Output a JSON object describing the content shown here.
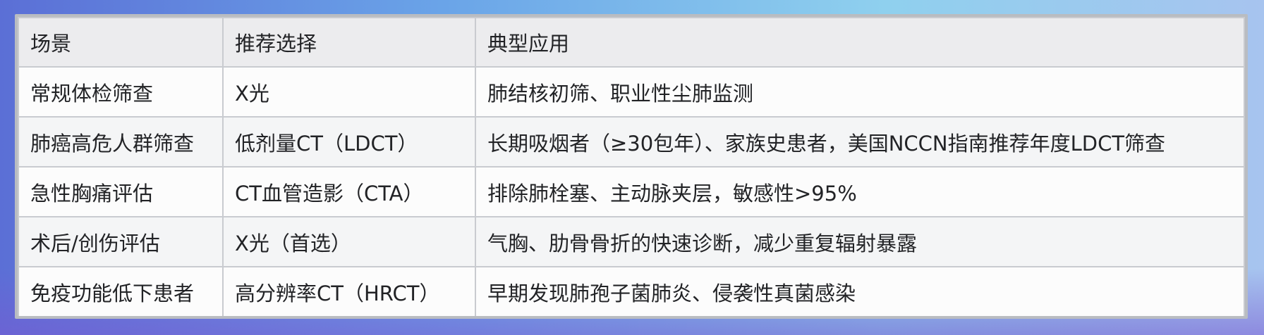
{
  "table": {
    "headers": [
      "场景",
      "推荐选择",
      "典型应用"
    ],
    "rows": [
      [
        "常规体检筛查",
        "X光",
        "肺结核初筛、职业性尘肺监测"
      ],
      [
        "肺癌高危人群筛查",
        "低剂量CT（LDCT）",
        "长期吸烟者（≥30包年）、家族史患者，美国NCCN指南推荐年度LDCT筛查"
      ],
      [
        "急性胸痛评估",
        "CT血管造影（CTA）",
        "排除肺栓塞、主动脉夹层，敏感性>95%"
      ],
      [
        "术后/创伤评估",
        "X光（首选）",
        "气胸、肋骨骨折的快速诊断，减少重复辐射暴露"
      ],
      [
        "免疫功能低下患者",
        "高分辨率CT（HRCT）",
        "早期发现肺孢子菌肺炎、侵袭性真菌感染"
      ]
    ]
  }
}
